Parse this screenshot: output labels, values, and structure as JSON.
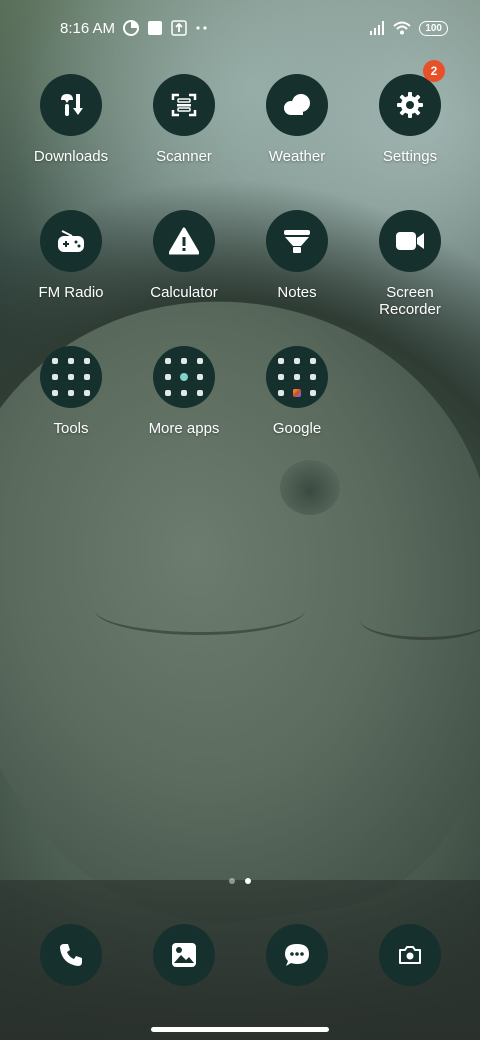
{
  "status_bar": {
    "time": "8:16 AM",
    "battery": "100",
    "icons": [
      "data-saver-icon",
      "square-notification-icon",
      "upload-icon",
      "more-dots-icon",
      "signal-icon",
      "wifi-icon",
      "battery-icon"
    ]
  },
  "apps": [
    {
      "label": "Downloads",
      "icon": "downloads-icon"
    },
    {
      "label": "Scanner",
      "icon": "scanner-icon"
    },
    {
      "label": "Weather",
      "icon": "weather-icon"
    },
    {
      "label": "Settings",
      "icon": "settings-gear-icon",
      "badge": "2"
    },
    {
      "label": "FM Radio",
      "icon": "fm-radio-icon"
    },
    {
      "label": "Calculator",
      "icon": "calculator-icon"
    },
    {
      "label": "Notes",
      "icon": "notes-icon"
    },
    {
      "label": "Screen Recorder",
      "icon": "screen-recorder-icon"
    },
    {
      "label": "Tools",
      "icon": "folder-icon"
    },
    {
      "label": "More apps",
      "icon": "folder-icon"
    },
    {
      "label": "Google",
      "icon": "folder-icon"
    }
  ],
  "pager": {
    "pages": 2,
    "active": 2
  },
  "dock": [
    {
      "name": "phone",
      "icon": "phone-icon"
    },
    {
      "name": "gallery",
      "icon": "gallery-icon"
    },
    {
      "name": "messages",
      "icon": "messages-icon"
    },
    {
      "name": "camera",
      "icon": "camera-icon"
    }
  ],
  "colors": {
    "icon_bg": "#16312d",
    "badge": "#e8502a"
  }
}
